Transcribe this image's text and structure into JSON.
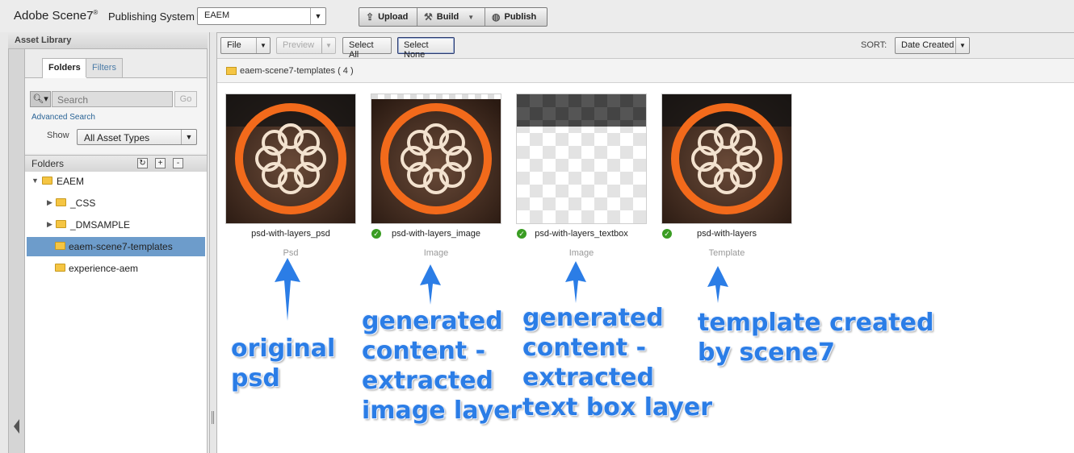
{
  "app": {
    "brand": "Adobe Scene7",
    "brand_reg": "®",
    "subtitle": "Publishing System",
    "company": "EAEM"
  },
  "toolbar": {
    "upload": "Upload",
    "build": "Build",
    "publish": "Publish"
  },
  "sidebar": {
    "title": "Asset Library",
    "tabs": [
      "Folders",
      "Filters"
    ],
    "search_placeholder": "Search",
    "go": "Go",
    "advanced": "Advanced Search",
    "show_label": "Show",
    "asset_type": "All Asset Types",
    "folders_header": "Folders",
    "tree": [
      {
        "label": "EAEM"
      },
      {
        "label": "_CSS"
      },
      {
        "label": "_DMSAMPLE"
      },
      {
        "label": "eaem-scene7-templates"
      },
      {
        "label": "experience-aem"
      }
    ]
  },
  "browser": {
    "file_menu": "File",
    "preview": "Preview",
    "select_all": "Select All",
    "select_none": "Select None",
    "sort_label": "SORT:",
    "sort_value": "Date Created",
    "path": "eaem-scene7-templates",
    "count": "( 4 )",
    "assets": [
      {
        "name": "psd-with-layers_psd",
        "type": "Psd",
        "status": false
      },
      {
        "name": "psd-with-layers_image",
        "type": "Image",
        "status": true
      },
      {
        "name": "psd-with-layers_textbox",
        "type": "Image",
        "status": true
      },
      {
        "name": "psd-with-layers",
        "type": "Template",
        "status": true
      }
    ]
  },
  "annotations": [
    "original\npsd",
    "generated\ncontent -\nextracted\nimage layer",
    "generated\ncontent -\nextracted\ntext box layer",
    "template created\nby scene7"
  ],
  "colors": {
    "accent_orange": "#f26a1b",
    "annotation_blue": "#2b7de6",
    "selected_row": "#6d9ccb"
  }
}
